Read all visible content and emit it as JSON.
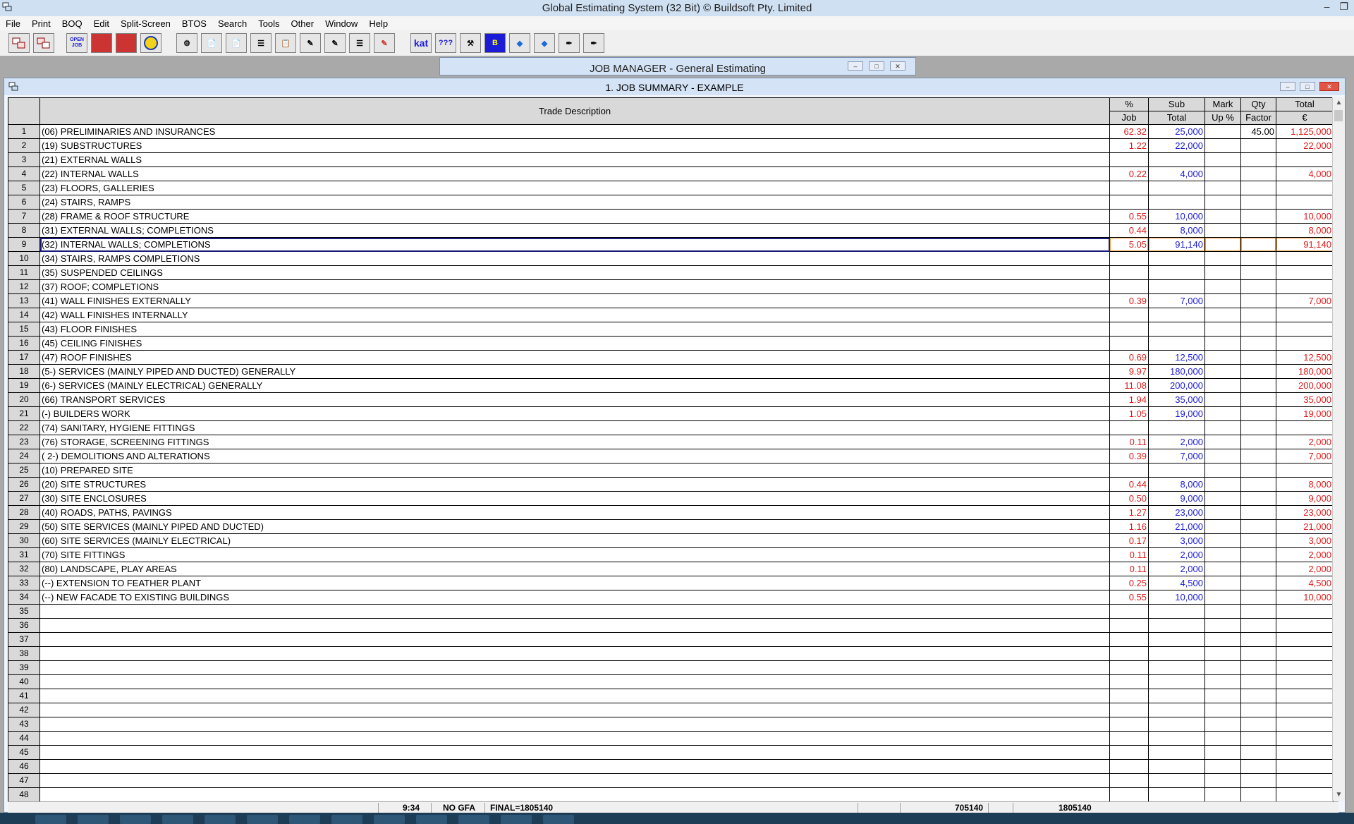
{
  "window": {
    "title": "Global Estimating System (32 Bit) © Buildsoft Pty. Limited"
  },
  "menu": [
    "File",
    "Print",
    "BOQ",
    "Edit",
    "Split-Screen",
    "BTOS",
    "Search",
    "Tools",
    "Other",
    "Window",
    "Help"
  ],
  "toolbar": {
    "icons": [
      "copy-window-icon",
      "paste-window-icon",
      "open-job-icon",
      "red-book-icon",
      "red-book-2-icon",
      "globe-icon",
      "stamp-icon",
      "document-icon",
      "document-2-icon",
      "list-back-icon",
      "clipboard-icon",
      "pen-1-icon",
      "pen-2-icon",
      "pen-3-icon",
      "pen-gr-icon",
      "kat-icon",
      "question-grid-icon",
      "tools-icon",
      "btos-icon",
      "diamond-1-icon",
      "diamond-2-icon",
      "pen-tool-1-icon",
      "pen-tool-2-icon"
    ],
    "labels": {
      "open": "OPEN JOB",
      "kat": "kat"
    }
  },
  "job_manager": {
    "title": "JOB MANAGER - General Estimating"
  },
  "job_window": {
    "title": "1. JOB SUMMARY - EXAMPLE"
  },
  "grid": {
    "headers": {
      "desc": "Trade Description",
      "pct_1": "%",
      "pct_2": "Job",
      "sub_1": "Sub",
      "sub_2": "Total",
      "mark_1": "Mark",
      "mark_2": "Up %",
      "qty_1": "Qty",
      "qty_2": "Factor",
      "total_1": "Total",
      "total_2": "€"
    },
    "selected_row": 9,
    "rows": [
      {
        "n": "1",
        "desc": "(06) PRELIMINARIES AND INSURANCES",
        "pct": "62.32",
        "sub": "25,000",
        "mark": "",
        "qty": "45.00",
        "total": "1,125,000"
      },
      {
        "n": "2",
        "desc": "(19) SUBSTRUCTURES",
        "pct": "1.22",
        "sub": "22,000",
        "mark": "",
        "qty": "",
        "total": "22,000"
      },
      {
        "n": "3",
        "desc": "(21) EXTERNAL WALLS",
        "pct": "",
        "sub": "",
        "mark": "",
        "qty": "",
        "total": ""
      },
      {
        "n": "4",
        "desc": "(22) INTERNAL WALLS",
        "pct": "0.22",
        "sub": "4,000",
        "mark": "",
        "qty": "",
        "total": "4,000"
      },
      {
        "n": "5",
        "desc": "(23) FLOORS, GALLERIES",
        "pct": "",
        "sub": "",
        "mark": "",
        "qty": "",
        "total": ""
      },
      {
        "n": "6",
        "desc": "(24) STAIRS, RAMPS",
        "pct": "",
        "sub": "",
        "mark": "",
        "qty": "",
        "total": ""
      },
      {
        "n": "7",
        "desc": "(28) FRAME & ROOF STRUCTURE",
        "pct": "0.55",
        "sub": "10,000",
        "mark": "",
        "qty": "",
        "total": "10,000"
      },
      {
        "n": "8",
        "desc": "(31) EXTERNAL WALLS; COMPLETIONS",
        "pct": "0.44",
        "sub": "8,000",
        "mark": "",
        "qty": "",
        "total": "8,000"
      },
      {
        "n": "9",
        "desc": "(32) INTERNAL WALLS; COMPLETIONS",
        "pct": "5.05",
        "sub": "91,140",
        "mark": "",
        "qty": "",
        "total": "91,140"
      },
      {
        "n": "10",
        "desc": "(34) STAIRS, RAMPS COMPLETIONS",
        "pct": "",
        "sub": "",
        "mark": "",
        "qty": "",
        "total": ""
      },
      {
        "n": "11",
        "desc": "(35) SUSPENDED CEILINGS",
        "pct": "",
        "sub": "",
        "mark": "",
        "qty": "",
        "total": ""
      },
      {
        "n": "12",
        "desc": "(37) ROOF; COMPLETIONS",
        "pct": "",
        "sub": "",
        "mark": "",
        "qty": "",
        "total": ""
      },
      {
        "n": "13",
        "desc": "(41) WALL FINISHES EXTERNALLY",
        "pct": "0.39",
        "sub": "7,000",
        "mark": "",
        "qty": "",
        "total": "7,000"
      },
      {
        "n": "14",
        "desc": "(42) WALL FINISHES INTERNALLY",
        "pct": "",
        "sub": "",
        "mark": "",
        "qty": "",
        "total": ""
      },
      {
        "n": "15",
        "desc": "(43) FLOOR FINISHES",
        "pct": "",
        "sub": "",
        "mark": "",
        "qty": "",
        "total": ""
      },
      {
        "n": "16",
        "desc": "(45) CEILING FINISHES",
        "pct": "",
        "sub": "",
        "mark": "",
        "qty": "",
        "total": ""
      },
      {
        "n": "17",
        "desc": "(47) ROOF FINISHES",
        "pct": "0.69",
        "sub": "12,500",
        "mark": "",
        "qty": "",
        "total": "12,500"
      },
      {
        "n": "18",
        "desc": "(5-) SERVICES (MAINLY PIPED AND DUCTED) GENERALLY",
        "pct": "9.97",
        "sub": "180,000",
        "mark": "",
        "qty": "",
        "total": "180,000"
      },
      {
        "n": "19",
        "desc": "(6-) SERVICES (MAINLY ELECTRICAL) GENERALLY",
        "pct": "11.08",
        "sub": "200,000",
        "mark": "",
        "qty": "",
        "total": "200,000"
      },
      {
        "n": "20",
        "desc": "(66) TRANSPORT SERVICES",
        "pct": "1.94",
        "sub": "35,000",
        "mark": "",
        "qty": "",
        "total": "35,000"
      },
      {
        "n": "21",
        "desc": "(-) BUILDERS WORK",
        "pct": "1.05",
        "sub": "19,000",
        "mark": "",
        "qty": "",
        "total": "19,000"
      },
      {
        "n": "22",
        "desc": "(74) SANITARY, HYGIENE FITTINGS",
        "pct": "",
        "sub": "",
        "mark": "",
        "qty": "",
        "total": ""
      },
      {
        "n": "23",
        "desc": "(76) STORAGE, SCREENING FITTINGS",
        "pct": "0.11",
        "sub": "2,000",
        "mark": "",
        "qty": "",
        "total": "2,000"
      },
      {
        "n": "24",
        "desc": "( 2-) DEMOLITIONS AND ALTERATIONS",
        "pct": "0.39",
        "sub": "7,000",
        "mark": "",
        "qty": "",
        "total": "7,000"
      },
      {
        "n": "25",
        "desc": "(10) PREPARED SITE",
        "pct": "",
        "sub": "",
        "mark": "",
        "qty": "",
        "total": ""
      },
      {
        "n": "26",
        "desc": "(20) SITE STRUCTURES",
        "pct": "0.44",
        "sub": "8,000",
        "mark": "",
        "qty": "",
        "total": "8,000"
      },
      {
        "n": "27",
        "desc": "(30) SITE ENCLOSURES",
        "pct": "0.50",
        "sub": "9,000",
        "mark": "",
        "qty": "",
        "total": "9,000"
      },
      {
        "n": "28",
        "desc": "(40) ROADS, PATHS, PAVINGS",
        "pct": "1.27",
        "sub": "23,000",
        "mark": "",
        "qty": "",
        "total": "23,000"
      },
      {
        "n": "29",
        "desc": "(50) SITE SERVICES (MAINLY PIPED AND DUCTED)",
        "pct": "1.16",
        "sub": "21,000",
        "mark": "",
        "qty": "",
        "total": "21,000"
      },
      {
        "n": "30",
        "desc": "(60) SITE SERVICES (MAINLY ELECTRICAL)",
        "pct": "0.17",
        "sub": "3,000",
        "mark": "",
        "qty": "",
        "total": "3,000"
      },
      {
        "n": "31",
        "desc": "(70) SITE FITTINGS",
        "pct": "0.11",
        "sub": "2,000",
        "mark": "",
        "qty": "",
        "total": "2,000"
      },
      {
        "n": "32",
        "desc": "(80) LANDSCAPE, PLAY AREAS",
        "pct": "0.11",
        "sub": "2,000",
        "mark": "",
        "qty": "",
        "total": "2,000"
      },
      {
        "n": "33",
        "desc": "(--) EXTENSION TO FEATHER PLANT",
        "pct": "0.25",
        "sub": "4,500",
        "mark": "",
        "qty": "",
        "total": "4,500"
      },
      {
        "n": "34",
        "desc": "(--) NEW FACADE TO EXISTING BUILDINGS",
        "pct": "0.55",
        "sub": "10,000",
        "mark": "",
        "qty": "",
        "total": "10,000"
      },
      {
        "n": "35",
        "desc": "",
        "pct": "",
        "sub": "",
        "mark": "",
        "qty": "",
        "total": ""
      },
      {
        "n": "36",
        "desc": "",
        "pct": "",
        "sub": "",
        "mark": "",
        "qty": "",
        "total": ""
      },
      {
        "n": "37",
        "desc": "",
        "pct": "",
        "sub": "",
        "mark": "",
        "qty": "",
        "total": ""
      },
      {
        "n": "38",
        "desc": "",
        "pct": "",
        "sub": "",
        "mark": "",
        "qty": "",
        "total": ""
      },
      {
        "n": "39",
        "desc": "",
        "pct": "",
        "sub": "",
        "mark": "",
        "qty": "",
        "total": ""
      },
      {
        "n": "40",
        "desc": "",
        "pct": "",
        "sub": "",
        "mark": "",
        "qty": "",
        "total": ""
      },
      {
        "n": "41",
        "desc": "",
        "pct": "",
        "sub": "",
        "mark": "",
        "qty": "",
        "total": ""
      },
      {
        "n": "42",
        "desc": "",
        "pct": "",
        "sub": "",
        "mark": "",
        "qty": "",
        "total": ""
      },
      {
        "n": "43",
        "desc": "",
        "pct": "",
        "sub": "",
        "mark": "",
        "qty": "",
        "total": ""
      },
      {
        "n": "44",
        "desc": "",
        "pct": "",
        "sub": "",
        "mark": "",
        "qty": "",
        "total": ""
      },
      {
        "n": "45",
        "desc": "",
        "pct": "",
        "sub": "",
        "mark": "",
        "qty": "",
        "total": ""
      },
      {
        "n": "46",
        "desc": "",
        "pct": "",
        "sub": "",
        "mark": "",
        "qty": "",
        "total": ""
      },
      {
        "n": "47",
        "desc": "",
        "pct": "",
        "sub": "",
        "mark": "",
        "qty": "",
        "total": ""
      },
      {
        "n": "48",
        "desc": "",
        "pct": "",
        "sub": "",
        "mark": "",
        "qty": "",
        "total": ""
      }
    ]
  },
  "status": {
    "time": "9:34",
    "gfa": "NO GFA",
    "final": "FINAL=1805140",
    "subtotal": "705140",
    "total": "1805140"
  },
  "colors": {
    "pct": "#e01b1b",
    "sub": "#1c1cd8",
    "total": "#e01b1b",
    "qty": "#000000"
  }
}
